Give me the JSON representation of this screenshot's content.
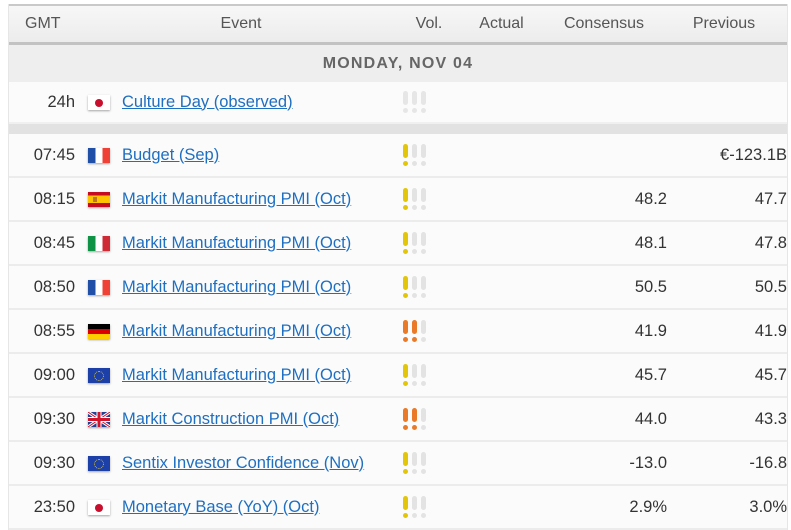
{
  "header": {
    "columns": [
      "GMT",
      "Event",
      "Vol.",
      "Actual",
      "Consensus",
      "Previous"
    ]
  },
  "day_label": "MONDAY, NOV 04",
  "colors": {
    "link": "#1f6fc1",
    "vol_low": "#e3c60a",
    "vol_medium": "#ea7a28",
    "vol_inactive": "#e3e3e3",
    "holiday_vol": "#e6e6e6"
  },
  "holiday": {
    "time": "24h",
    "country": "Japan",
    "flag": "jp",
    "event": "Culture Day (observed)",
    "volatility": 0
  },
  "events": [
    {
      "time": "07:45",
      "country": "France",
      "flag": "fr",
      "event": "Budget (Sep)",
      "volatility": 1,
      "actual": "",
      "consensus": "",
      "previous": "€-123.1B"
    },
    {
      "time": "08:15",
      "country": "Spain",
      "flag": "es",
      "event": "Markit Manufacturing PMI (Oct)",
      "volatility": 1,
      "actual": "",
      "consensus": "48.2",
      "previous": "47.7"
    },
    {
      "time": "08:45",
      "country": "Italy",
      "flag": "it",
      "event": "Markit Manufacturing PMI (Oct)",
      "volatility": 1,
      "actual": "",
      "consensus": "48.1",
      "previous": "47.8"
    },
    {
      "time": "08:50",
      "country": "France",
      "flag": "fr",
      "event": "Markit Manufacturing PMI (Oct)",
      "volatility": 1,
      "actual": "",
      "consensus": "50.5",
      "previous": "50.5"
    },
    {
      "time": "08:55",
      "country": "Germany",
      "flag": "de",
      "event": "Markit Manufacturing PMI (Oct)",
      "volatility": 2,
      "actual": "",
      "consensus": "41.9",
      "previous": "41.9"
    },
    {
      "time": "09:00",
      "country": "European Union",
      "flag": "eu",
      "event": "Markit Manufacturing PMI (Oct)",
      "volatility": 1,
      "actual": "",
      "consensus": "45.7",
      "previous": "45.7"
    },
    {
      "time": "09:30",
      "country": "United Kingdom",
      "flag": "gb",
      "event": "Markit Construction PMI (Oct)",
      "volatility": 2,
      "actual": "",
      "consensus": "44.0",
      "previous": "43.3"
    },
    {
      "time": "09:30",
      "country": "European Union",
      "flag": "eu",
      "event": "Sentix Investor Confidence (Nov)",
      "volatility": 1,
      "actual": "",
      "consensus": "-13.0",
      "previous": "-16.8"
    },
    {
      "time": "23:50",
      "country": "Japan",
      "flag": "jp",
      "event": "Monetary Base (YoY) (Oct)",
      "volatility": 1,
      "actual": "",
      "consensus": "2.9%",
      "previous": "3.0%"
    }
  ]
}
